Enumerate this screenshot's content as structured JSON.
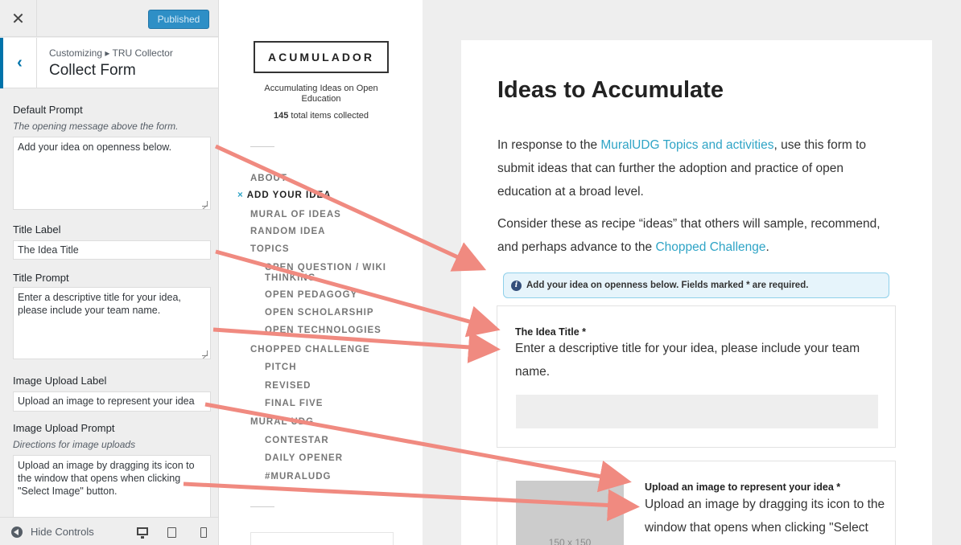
{
  "customizer": {
    "close_icon": "close-icon",
    "published_label": "Published",
    "breadcrumb": "Customizing ▸ TRU Collector",
    "section_title": "Collect Form",
    "controls": {
      "default_prompt_label": "Default Prompt",
      "default_prompt_desc": "The opening message above the form.",
      "default_prompt_value": "Add your idea on openness below.",
      "title_label_label": "Title Label",
      "title_label_value": "The Idea Title",
      "title_prompt_label": "Title Prompt",
      "title_prompt_value": "Enter a descriptive title for your idea, please include your team name.",
      "image_upload_label_label": "Image Upload Label",
      "image_upload_label_value": "Upload an image to represent your idea",
      "image_upload_prompt_label": "Image Upload Prompt",
      "image_upload_prompt_desc": "Directions for image uploads",
      "image_upload_prompt_value": "Upload an image by dragging its icon to the window that opens when clicking \"Select Image\" button."
    },
    "footer": {
      "hide_controls_label": "Hide Controls"
    },
    "colors": {
      "accent": "#0073aa",
      "published_bg": "#2e8fc6"
    }
  },
  "site": {
    "logo_text": "ACUMULADOR",
    "description": "Accumulating Ideas on Open Education",
    "count_number": "145",
    "count_text": " total items collected",
    "menu": {
      "about": "ABOUT",
      "add_your_idea": "ADD YOUR IDEA",
      "mural_of_ideas": "MURAL OF IDEAS",
      "random_idea": "RANDOM IDEA",
      "topics": "TOPICS",
      "open_question": "OPEN QUESTION / WIKI THINKING",
      "open_pedagogy": "OPEN PEDAGOGY",
      "open_scholarship": "OPEN SCHOLARSHIP",
      "open_technologies": "OPEN TECHNOLOGIES",
      "chopped_challenge": "CHOPPED CHALLENGE",
      "pitch": "PITCH",
      "revised": "REVISED",
      "final_five": "FINAL FIVE",
      "mural_udg": "MURAL UDG",
      "contestar": "CONTESTAR",
      "daily_opener": "DAILY OPENER",
      "muraludg": "#MURALUDG"
    },
    "active_marker": "×"
  },
  "content": {
    "title": "Ideas to Accumulate",
    "p1_before": "In response to the ",
    "p1_link": "MuralUDG Topics and activities",
    "p1_after": ", use this form to submit ideas that can further the adoption and practice of open education at a broad level.",
    "p2_before": "Consider these as recipe “ideas” that others will sample, recommend, and perhaps advance to the ",
    "p2_link": "Chopped Challenge",
    "p2_after": ".",
    "notice": "Add your idea on openness below. Fields marked * are required.",
    "title_field_label": "The Idea Title *",
    "title_field_prompt": "Enter a descriptive title for your idea, please include your team name.",
    "image_field_label": "Upload an image to represent your idea *",
    "image_field_prompt": "Upload an image by dragging its icon to the window that opens when clicking \"Select Image\" button.",
    "image_placeholder": "150 x 150",
    "link_color": "#2fa4c6"
  },
  "annotation_arrow_color": "#f08a80"
}
